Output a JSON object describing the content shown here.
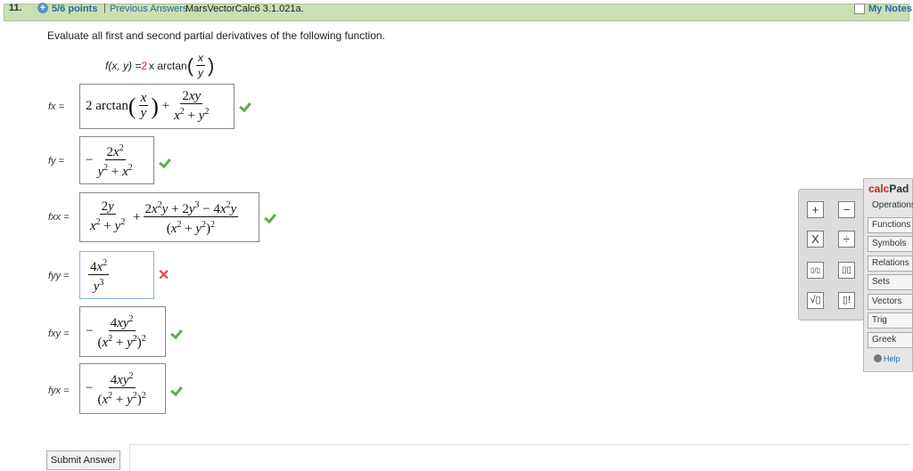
{
  "header": {
    "question_number": "11.",
    "points": "5/6 points",
    "separator": "|",
    "previous_answers": "Previous Answers",
    "problem_code": "MarsVectorCalc6 3.1.021a.",
    "my_notes": "My Notes"
  },
  "prompt": "Evaluate all first and second partial derivatives of the following function.",
  "function": {
    "lhs": "f(x, y) = ",
    "coef": "2",
    "rest": "x arctan",
    "frac_num": "x",
    "frac_den": "y"
  },
  "answers": [
    {
      "label": "fx =",
      "status": "correct"
    },
    {
      "label": "fy =",
      "status": "correct"
    },
    {
      "label": "fxx =",
      "status": "correct"
    },
    {
      "label": "fyy =",
      "status": "incorrect"
    },
    {
      "label": "fxy =",
      "status": "correct"
    },
    {
      "label": "fyx =",
      "status": "correct"
    }
  ],
  "submit": "Submit Answer",
  "calcpad": {
    "title_a": "calc",
    "title_b": "Pad",
    "operations": "Operations",
    "tabs": [
      "Functions",
      "Symbols",
      "Relations",
      "Sets",
      "Vectors",
      "Trig",
      "Greek"
    ],
    "help": "Help",
    "buttons": [
      "+",
      "−",
      "X",
      "÷",
      "▯/▯",
      "▯▯",
      "√▯",
      "▯!"
    ]
  },
  "colors": {
    "header_bg": "#c9dfb4",
    "link": "#2a6aa8",
    "correct": "#5cad4a",
    "incorrect": "#e04848"
  }
}
